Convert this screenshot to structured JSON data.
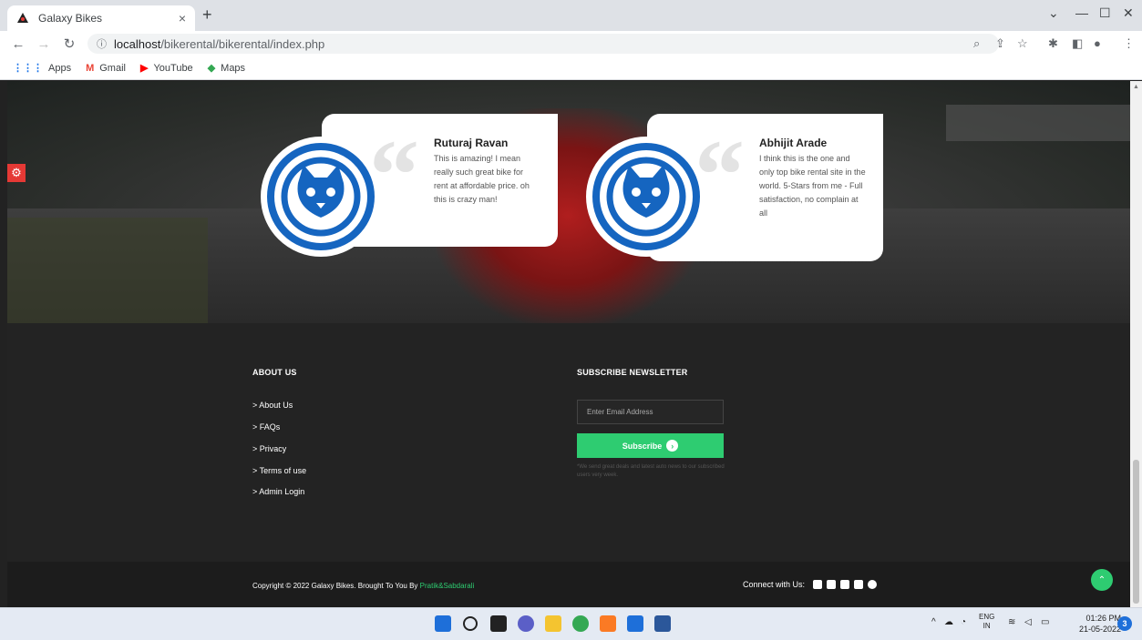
{
  "browser": {
    "tab_title": "Galaxy Bikes",
    "tab_close": "×",
    "new_tab": "+",
    "url_host": "localhost",
    "url_path": "/bikerental/bikerental/index.php",
    "bookmarks": [
      {
        "label": "Apps",
        "icon": "apps-grid-icon"
      },
      {
        "label": "Gmail",
        "icon": "gmail-icon"
      },
      {
        "label": "YouTube",
        "icon": "youtube-icon"
      },
      {
        "label": "Maps",
        "icon": "maps-icon"
      }
    ]
  },
  "testimonials": [
    {
      "name": "Ruturaj Ravan",
      "text": "This is amazing! I mean really such great bike for rent at affordable price. oh this is crazy man!"
    },
    {
      "name": "Abhijit Arade",
      "text": "I think this is the one and only top bike rental site in the world. 5-Stars from me - Full satisfaction, no complain at all"
    }
  ],
  "footer": {
    "about_heading": "ABOUT US",
    "links": [
      "> About Us",
      "> FAQs",
      "> Privacy",
      "> Terms of use",
      "> Admin Login"
    ],
    "newsletter_heading": "SUBSCRIBE NEWSLETTER",
    "email_placeholder": "Enter Email Address",
    "subscribe_label": "Subscribe",
    "note": "*We send great deals and latest auto news to our subscribed users very week."
  },
  "bottom": {
    "copyright": "Copyright © 2022 Galaxy Bikes. Brought To You By",
    "author": "Pratik&Sabdarali",
    "connect": "Connect with Us:",
    "social": [
      "facebook-icon",
      "twitter-icon",
      "linkedin-icon",
      "google-plus-icon",
      "instagram-icon"
    ]
  },
  "taskbar": {
    "lang_top": "ENG",
    "lang_bottom": "IN",
    "time": "01:26 PM",
    "date": "21-05-2022",
    "notifications": "3"
  },
  "colors": {
    "accent_green": "#2ecc71",
    "brand_blue": "#1565c0",
    "settings_red": "#e53935"
  }
}
